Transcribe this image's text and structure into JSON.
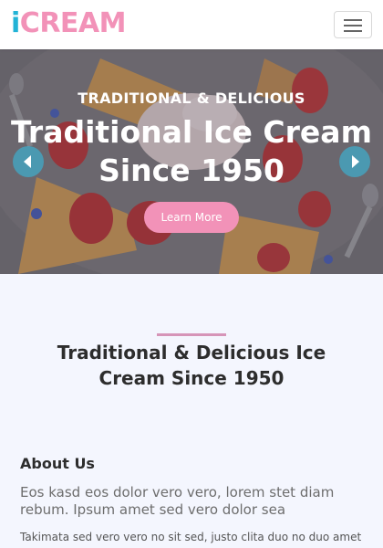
{
  "navbar": {
    "brand_i": "i",
    "brand_rest": "CREAM",
    "menu_icon": "hamburger-menu-icon"
  },
  "hero": {
    "eyebrow": "TRADITIONAL & DELICIOUS",
    "title_line1": "Traditional Ice Cream",
    "title_line2": "Since 1950",
    "button_label": "Learn More",
    "prev_icon": "chevron-left-icon",
    "next_icon": "chevron-right-icon"
  },
  "section": {
    "title_line1": "Traditional & Delicious Ice",
    "title_line2": "Cream Since 1950"
  },
  "about": {
    "heading": "About Us",
    "lead": "Eos kasd eos dolor vero vero, lorem stet diam rebum. Ipsum amet sed vero dolor sea",
    "body": "Takimata sed vero vero no sit sed, justo clita duo no duo amet"
  },
  "colors": {
    "brand_i": "#22b3d6",
    "brand_accent": "#f292b8",
    "page_background": "#f4f6fe",
    "divider": "#d695b8"
  }
}
